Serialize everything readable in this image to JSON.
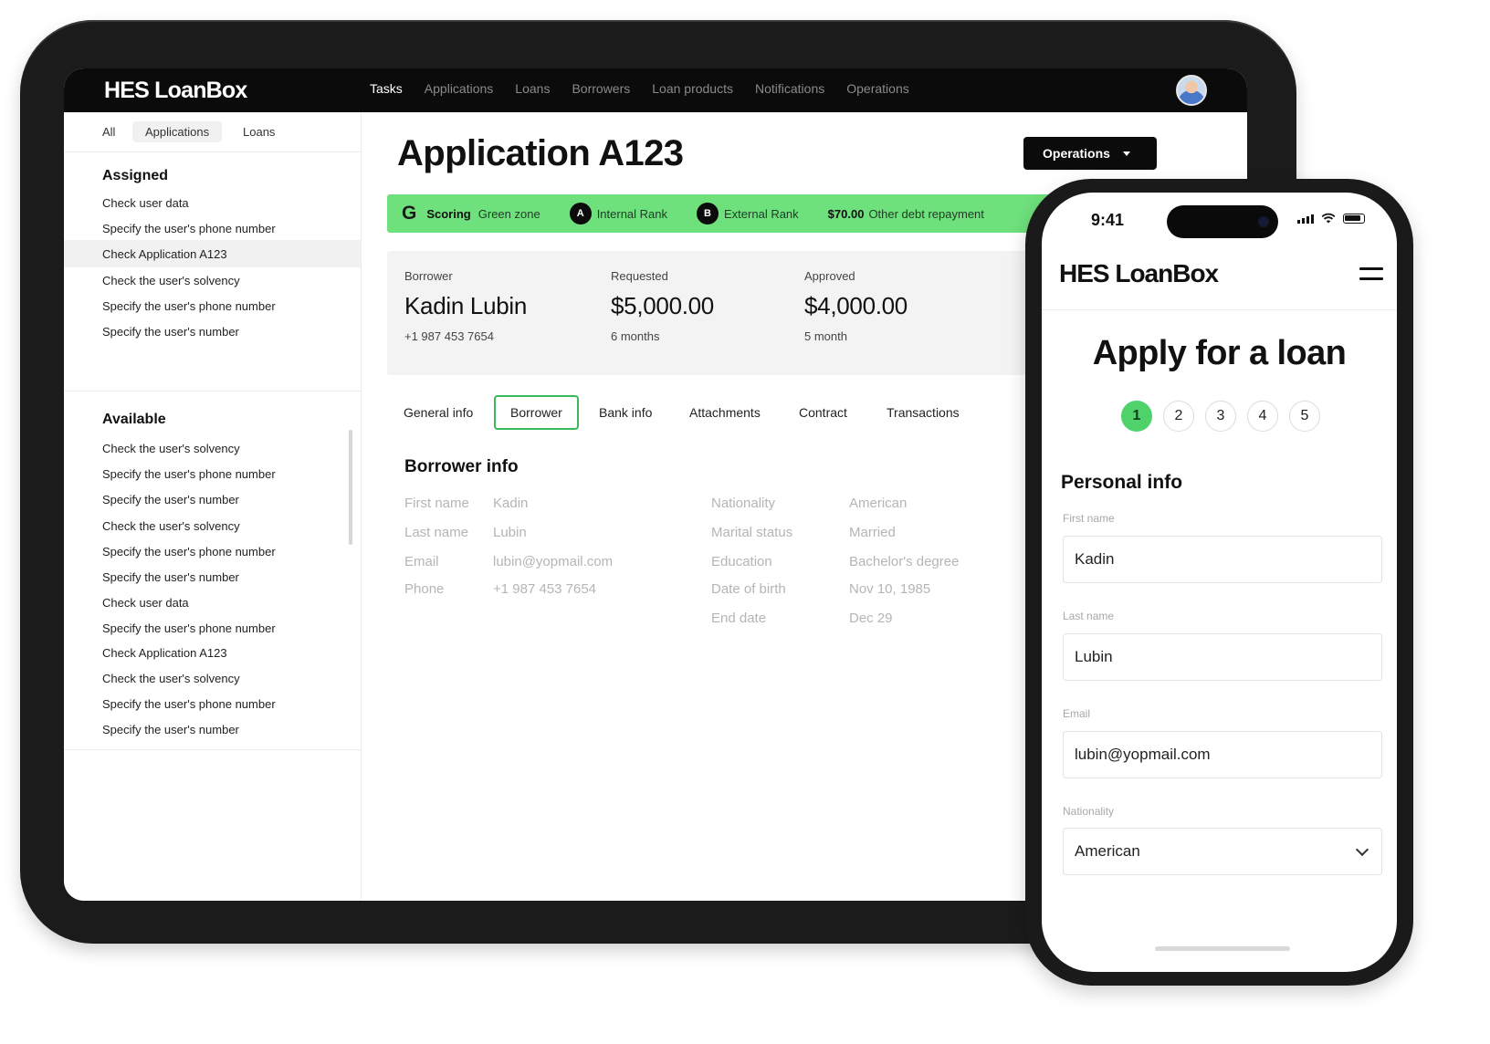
{
  "tablet": {
    "brand": "HES LoanBox",
    "nav": [
      "Tasks",
      "Applications",
      "Loans",
      "Borrowers",
      "Loan products",
      "Notifications",
      "Operations"
    ],
    "sidebar": {
      "tabs": [
        "All",
        "Applications",
        "Loans"
      ],
      "assigned_title": "Assigned",
      "assigned": [
        "Check user data",
        "Specify the user's phone number",
        "Check Application A123",
        "Check the user's solvency",
        "Specify the user's phone number",
        "Specify the user's number"
      ],
      "available_title": "Available",
      "available": [
        "Check the user's solvency",
        "Specify the user's phone number",
        "Specify the user's number",
        "Check the user's solvency",
        "Specify the user's phone number",
        "Specify the user's number",
        "Check user data",
        "Specify the user's phone number",
        "Check Application A123",
        "Check the user's solvency",
        "Specify the user's phone number",
        "Specify the user's number"
      ]
    },
    "page_title": "Application A123",
    "operations_button": "Operations",
    "scoring": {
      "icon_letter": "G",
      "label": "Scoring",
      "zone": "Green zone",
      "internal_badge": "A",
      "internal_label": "Internal Rank",
      "external_badge": "B",
      "external_label": "External Rank",
      "debt_amount": "$70.00",
      "debt_label": "Other debt repayment"
    },
    "summary": {
      "borrower_label": "Borrower",
      "borrower_name": "Kadin Lubin",
      "borrower_phone": "+1 987 453 7654",
      "requested_label": "Requested",
      "requested_amount": "$5,000.00",
      "requested_term": "6 months",
      "approved_label": "Approved",
      "approved_amount": "$4,000.00",
      "approved_term": "5 month"
    },
    "tabs": [
      "General info",
      "Borrower",
      "Bank info",
      "Attachments",
      "Contract",
      "Transactions"
    ],
    "borrower_info": {
      "title": "Borrower info",
      "left": [
        {
          "label": "First name",
          "value": "Kadin"
        },
        {
          "label": "Last name",
          "value": "Lubin"
        },
        {
          "label": "Email",
          "value": "lubin@yopmail.com"
        },
        {
          "label": "Phone",
          "value": "+1 987 453 7654"
        }
      ],
      "right": [
        {
          "label": "Nationality",
          "value": "American"
        },
        {
          "label": "Marital status",
          "value": "Married"
        },
        {
          "label": "Education",
          "value": "Bachelor's degree"
        },
        {
          "label": "Date of birth",
          "value": "Nov 10, 1985"
        },
        {
          "label": "End date",
          "value": "Dec 29"
        }
      ]
    }
  },
  "phone": {
    "time": "9:41",
    "brand": "HES LoanBox",
    "title": "Apply for a loan",
    "steps": [
      "1",
      "2",
      "3",
      "4",
      "5"
    ],
    "current_step": 1,
    "section": "Personal info",
    "fields": [
      {
        "label": "First name",
        "value": "Kadin"
      },
      {
        "label": "Last name",
        "value": "Lubin"
      },
      {
        "label": "Email",
        "value": "lubin@yopmail.com"
      },
      {
        "label": "Nationality",
        "value": "American"
      }
    ]
  },
  "colors": {
    "accent_green": "#6ee07c",
    "step_green": "#4fd26a",
    "tab_border_green": "#3cb859",
    "dark": "#0b0b0b"
  }
}
